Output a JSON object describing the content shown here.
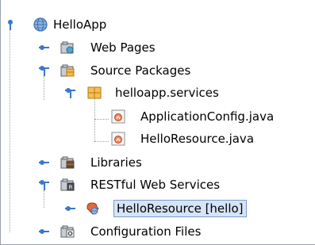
{
  "tree": {
    "root": {
      "label": "HelloApp",
      "icon": "globe-project-icon"
    },
    "web_pages": {
      "label": "Web Pages",
      "icon": "web-pages-folder-icon"
    },
    "source_packages": {
      "label": "Source Packages",
      "icon": "source-packages-folder-icon"
    },
    "package": {
      "label": "helloapp.services",
      "icon": "package-icon"
    },
    "file1": {
      "label": "ApplicationConfig.java",
      "icon": "java-class-icon"
    },
    "file2": {
      "label": "HelloResource.java",
      "icon": "java-class-icon"
    },
    "libraries": {
      "label": "Libraries",
      "icon": "libraries-folder-icon"
    },
    "restful": {
      "label": "RESTful Web Services",
      "icon": "rest-services-folder-icon"
    },
    "resource": {
      "label": "HelloResource [hello]",
      "icon": "rest-resource-icon",
      "selected": true
    },
    "config": {
      "label": "Configuration Files",
      "icon": "config-files-folder-icon"
    }
  },
  "colors": {
    "selection_bg": "#d6e4f7",
    "selection_border": "#7a9cc9",
    "toggle_blue": "#3a78c9"
  }
}
